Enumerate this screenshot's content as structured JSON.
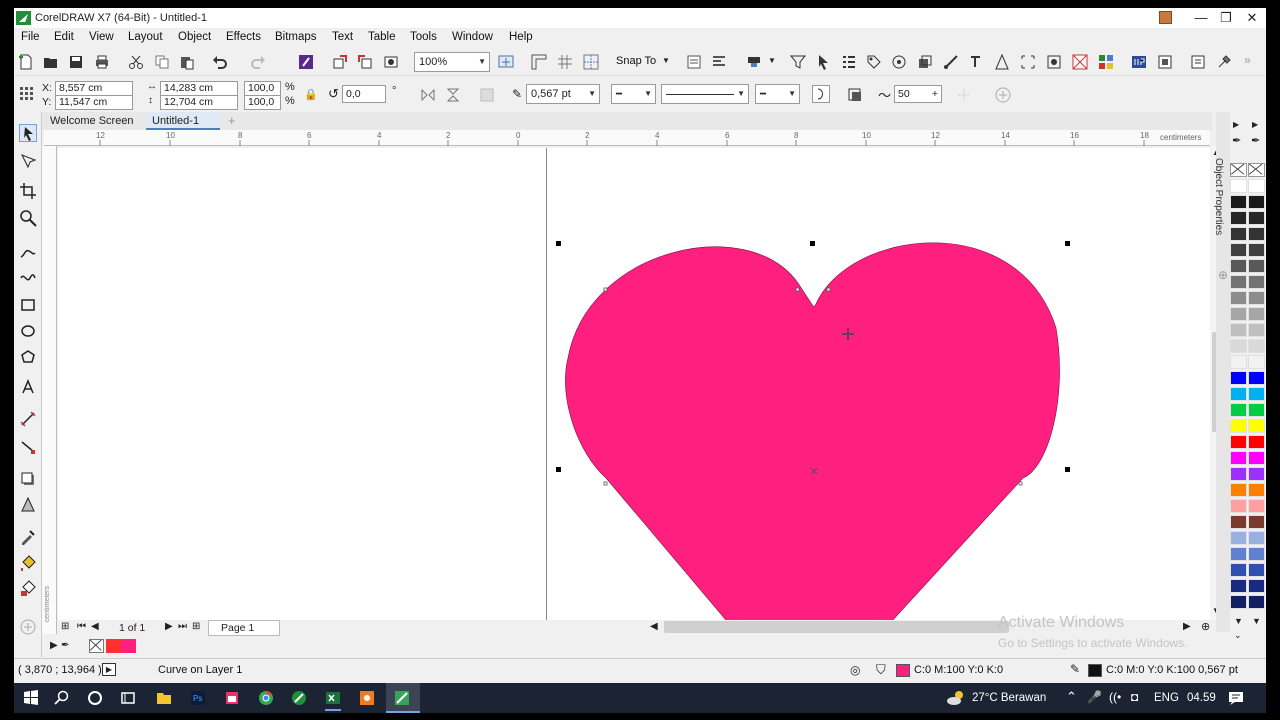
{
  "window": {
    "title": "CorelDRAW X7 (64-Bit) - Untitled-1",
    "minimize": "—",
    "restore": "❐",
    "close": "✕"
  },
  "menu": [
    "File",
    "Edit",
    "View",
    "Layout",
    "Object",
    "Effects",
    "Bitmaps",
    "Text",
    "Table",
    "Tools",
    "Window",
    "Help"
  ],
  "toolbar1": {
    "zoom": "100%",
    "snap_to": "Snap To"
  },
  "property_bar": {
    "x_label": "X:",
    "x_value": "8,557 cm",
    "y_label": "Y:",
    "y_value": "11,547 cm",
    "width_value": "14,283 cm",
    "height_value": "12,704 cm",
    "scale_w": "100,0",
    "scale_h": "100,0",
    "percent": "%",
    "rotation": "0,0",
    "degree": "°",
    "outline_width": "0,567 pt",
    "smoothing": "50"
  },
  "tabs": [
    "Welcome Screen",
    "Untitled-1"
  ],
  "ruler_h_ticks": [
    "12",
    "10",
    "8",
    "6",
    "4",
    "2",
    "0",
    "2",
    "4",
    "6",
    "8",
    "10",
    "12",
    "14",
    "16",
    "18"
  ],
  "ruler_units": "centimeters",
  "ruler_v_units": "centimeters",
  "docker": {
    "label": "Object Properties"
  },
  "page_nav": {
    "page_count": "1 of 1",
    "page_tab": "Page 1"
  },
  "status": {
    "cursor_coords": "( 3,870 ; 13,964 )",
    "object_info": "Curve on Layer 1",
    "fill_info": "C:0 M:100 Y:0 K:0",
    "outline_info": "C:0 M:0 Y:0 K:100  0,567 pt"
  },
  "watermark": {
    "line1": "Activate Windows",
    "line2": "Go to Settings to activate Windows."
  },
  "taskbar": {
    "weather": "27°C  Berawan",
    "language": "ENG",
    "time": "04.59"
  },
  "colors": {
    "heart_fill": "#ff1f7e",
    "accent_green": "#1f8f3a"
  },
  "palette_colors": [
    "#ffffff",
    "#1a1a1a",
    "#262626",
    "#333333",
    "#404040",
    "#595959",
    "#737373",
    "#8c8c8c",
    "#a6a6a6",
    "#bfbfbf",
    "#d9d9d9",
    "#f2f2f2",
    "#0000ff",
    "#00b0f0",
    "#00cc44",
    "#ffff00",
    "#ff0000",
    "#ff00ff",
    "#9b30ff",
    "#ff8000",
    "#ffa0a0",
    "#7a3b2e",
    "#9ab0e0",
    "#6080d0",
    "#3050b0",
    "#1a2a80",
    "#102060"
  ]
}
